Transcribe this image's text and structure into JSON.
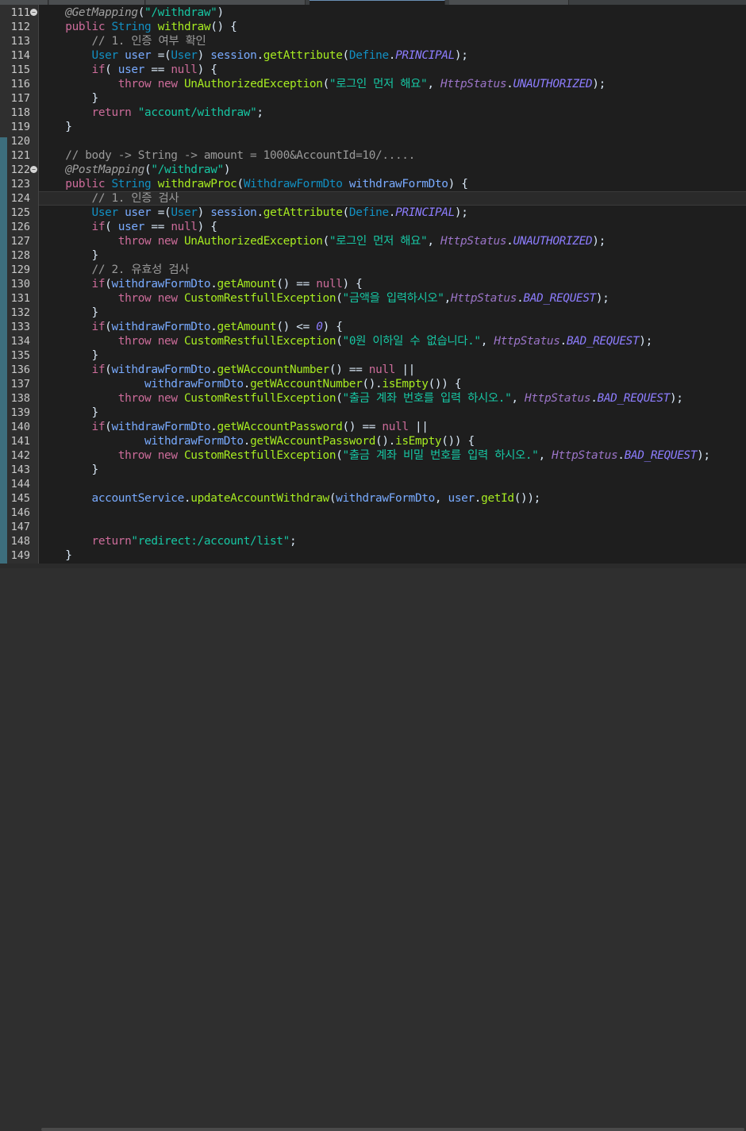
{
  "tabs": [
    "",
    "",
    "",
    "",
    ""
  ],
  "lines": [
    {
      "n": "111",
      "fold": true,
      "t": [
        [
          "    ",
          "txt"
        ],
        [
          "@GetMapping",
          "ann"
        ],
        [
          "(",
          "txt"
        ],
        [
          "\"/withdraw\"",
          "str"
        ],
        [
          ")",
          "txt"
        ]
      ]
    },
    {
      "n": "112",
      "t": [
        [
          "    ",
          "txt"
        ],
        [
          "public",
          "kw"
        ],
        [
          " ",
          "txt"
        ],
        [
          "String",
          "type"
        ],
        [
          " ",
          "txt"
        ],
        [
          "withdraw",
          "meth"
        ],
        [
          "() {",
          "txt"
        ]
      ]
    },
    {
      "n": "113",
      "t": [
        [
          "        ",
          "txt"
        ],
        [
          "// 1. 인증 여부 확인",
          "cmt"
        ]
      ]
    },
    {
      "n": "114",
      "t": [
        [
          "        ",
          "txt"
        ],
        [
          "User",
          "type"
        ],
        [
          " ",
          "txt"
        ],
        [
          "user",
          "var"
        ],
        [
          " =(",
          "txt"
        ],
        [
          "User",
          "type"
        ],
        [
          ") ",
          "txt"
        ],
        [
          "session",
          "var"
        ],
        [
          ".",
          "txt"
        ],
        [
          "getAttribute",
          "meth"
        ],
        [
          "(",
          "txt"
        ],
        [
          "Define",
          "type"
        ],
        [
          ".",
          "txt"
        ],
        [
          "PRINCIPAL",
          "cst"
        ],
        [
          ");",
          "txt"
        ]
      ]
    },
    {
      "n": "115",
      "t": [
        [
          "        ",
          "txt"
        ],
        [
          "if",
          "kw"
        ],
        [
          "( ",
          "txt"
        ],
        [
          "user",
          "var"
        ],
        [
          " == ",
          "txt"
        ],
        [
          "null",
          "kw"
        ],
        [
          ") {",
          "txt"
        ]
      ]
    },
    {
      "n": "116",
      "t": [
        [
          "            ",
          "txt"
        ],
        [
          "throw",
          "kw"
        ],
        [
          " ",
          "txt"
        ],
        [
          "new",
          "kw"
        ],
        [
          " ",
          "txt"
        ],
        [
          "UnAuthorizedException",
          "meth"
        ],
        [
          "(",
          "txt"
        ],
        [
          "\"로그인 먼저 해요\"",
          "str"
        ],
        [
          ", ",
          "txt"
        ],
        [
          "HttpStatus",
          "stat"
        ],
        [
          ".",
          "txt"
        ],
        [
          "UNAUTHORIZED",
          "cst"
        ],
        [
          ");",
          "txt"
        ]
      ]
    },
    {
      "n": "117",
      "t": [
        [
          "        }",
          "txt"
        ]
      ]
    },
    {
      "n": "118",
      "t": [
        [
          "        ",
          "txt"
        ],
        [
          "return",
          "kw"
        ],
        [
          " ",
          "txt"
        ],
        [
          "\"account/withdraw\"",
          "str"
        ],
        [
          ";",
          "txt"
        ]
      ]
    },
    {
      "n": "119",
      "t": [
        [
          "    }",
          "txt"
        ]
      ]
    },
    {
      "n": "120",
      "t": []
    },
    {
      "n": "121",
      "t": [
        [
          "    ",
          "txt"
        ],
        [
          "// body -> String -> amount = 1000&AccountId=10/.....",
          "cmt"
        ]
      ]
    },
    {
      "n": "122",
      "fold": true,
      "t": [
        [
          "    ",
          "txt"
        ],
        [
          "@PostMapping",
          "ann"
        ],
        [
          "(",
          "txt"
        ],
        [
          "\"/withdraw\"",
          "str"
        ],
        [
          ")",
          "txt"
        ]
      ]
    },
    {
      "n": "123",
      "t": [
        [
          "    ",
          "txt"
        ],
        [
          "public",
          "kw"
        ],
        [
          " ",
          "txt"
        ],
        [
          "String",
          "type"
        ],
        [
          " ",
          "txt"
        ],
        [
          "withdrawProc",
          "meth"
        ],
        [
          "(",
          "txt"
        ],
        [
          "WithdrawFormDto",
          "type"
        ],
        [
          " ",
          "txt"
        ],
        [
          "withdrawFormDto",
          "var"
        ],
        [
          ") {",
          "txt"
        ]
      ]
    },
    {
      "n": "124",
      "hl": true,
      "t": [
        [
          "        ",
          "txt"
        ],
        [
          "// 1. 인증 검사",
          "cmt"
        ]
      ]
    },
    {
      "n": "125",
      "t": [
        [
          "        ",
          "txt"
        ],
        [
          "User",
          "type"
        ],
        [
          " ",
          "txt"
        ],
        [
          "user",
          "var"
        ],
        [
          " =(",
          "txt"
        ],
        [
          "User",
          "type"
        ],
        [
          ") ",
          "txt"
        ],
        [
          "session",
          "var"
        ],
        [
          ".",
          "txt"
        ],
        [
          "getAttribute",
          "meth"
        ],
        [
          "(",
          "txt"
        ],
        [
          "Define",
          "type"
        ],
        [
          ".",
          "txt"
        ],
        [
          "PRINCIPAL",
          "cst"
        ],
        [
          ");",
          "txt"
        ]
      ]
    },
    {
      "n": "126",
      "t": [
        [
          "        ",
          "txt"
        ],
        [
          "if",
          "kw"
        ],
        [
          "( ",
          "txt"
        ],
        [
          "user",
          "var"
        ],
        [
          " == ",
          "txt"
        ],
        [
          "null",
          "kw"
        ],
        [
          ") {",
          "txt"
        ]
      ]
    },
    {
      "n": "127",
      "t": [
        [
          "            ",
          "txt"
        ],
        [
          "throw",
          "kw"
        ],
        [
          " ",
          "txt"
        ],
        [
          "new",
          "kw"
        ],
        [
          " ",
          "txt"
        ],
        [
          "UnAuthorizedException",
          "meth"
        ],
        [
          "(",
          "txt"
        ],
        [
          "\"로그인 먼저 해요\"",
          "str"
        ],
        [
          ", ",
          "txt"
        ],
        [
          "HttpStatus",
          "stat"
        ],
        [
          ".",
          "txt"
        ],
        [
          "UNAUTHORIZED",
          "cst"
        ],
        [
          ");",
          "txt"
        ]
      ]
    },
    {
      "n": "128",
      "t": [
        [
          "        }",
          "txt"
        ]
      ]
    },
    {
      "n": "129",
      "t": [
        [
          "        ",
          "txt"
        ],
        [
          "// 2. 유효성 검사",
          "cmt"
        ]
      ]
    },
    {
      "n": "130",
      "t": [
        [
          "        ",
          "txt"
        ],
        [
          "if",
          "kw"
        ],
        [
          "(",
          "txt"
        ],
        [
          "withdrawFormDto",
          "var"
        ],
        [
          ".",
          "txt"
        ],
        [
          "getAmount",
          "meth"
        ],
        [
          "() == ",
          "txt"
        ],
        [
          "null",
          "kw"
        ],
        [
          ") {",
          "txt"
        ]
      ]
    },
    {
      "n": "131",
      "t": [
        [
          "            ",
          "txt"
        ],
        [
          "throw",
          "kw"
        ],
        [
          " ",
          "txt"
        ],
        [
          "new",
          "kw"
        ],
        [
          " ",
          "txt"
        ],
        [
          "CustomRestfullException",
          "meth"
        ],
        [
          "(",
          "txt"
        ],
        [
          "\"금액을 입력하시오\"",
          "str"
        ],
        [
          ",",
          "txt"
        ],
        [
          "HttpStatus",
          "stat"
        ],
        [
          ".",
          "txt"
        ],
        [
          "BAD_REQUEST",
          "cst"
        ],
        [
          ");",
          "txt"
        ]
      ]
    },
    {
      "n": "132",
      "t": [
        [
          "        }",
          "txt"
        ]
      ]
    },
    {
      "n": "133",
      "t": [
        [
          "        ",
          "txt"
        ],
        [
          "if",
          "kw"
        ],
        [
          "(",
          "txt"
        ],
        [
          "withdrawFormDto",
          "var"
        ],
        [
          ".",
          "txt"
        ],
        [
          "getAmount",
          "meth"
        ],
        [
          "() <= ",
          "txt"
        ],
        [
          "0",
          "cst"
        ],
        [
          ") {",
          "txt"
        ]
      ]
    },
    {
      "n": "134",
      "t": [
        [
          "            ",
          "txt"
        ],
        [
          "throw",
          "kw"
        ],
        [
          " ",
          "txt"
        ],
        [
          "new",
          "kw"
        ],
        [
          " ",
          "txt"
        ],
        [
          "CustomRestfullException",
          "meth"
        ],
        [
          "(",
          "txt"
        ],
        [
          "\"0원 이하일 수 없습니다.\"",
          "str"
        ],
        [
          ", ",
          "txt"
        ],
        [
          "HttpStatus",
          "stat"
        ],
        [
          ".",
          "txt"
        ],
        [
          "BAD_REQUEST",
          "cst"
        ],
        [
          ");",
          "txt"
        ]
      ]
    },
    {
      "n": "135",
      "t": [
        [
          "        }",
          "txt"
        ]
      ]
    },
    {
      "n": "136",
      "t": [
        [
          "        ",
          "txt"
        ],
        [
          "if",
          "kw"
        ],
        [
          "(",
          "txt"
        ],
        [
          "withdrawFormDto",
          "var"
        ],
        [
          ".",
          "txt"
        ],
        [
          "getWAccountNumber",
          "meth"
        ],
        [
          "() == ",
          "txt"
        ],
        [
          "null",
          "kw"
        ],
        [
          " ||",
          "txt"
        ]
      ]
    },
    {
      "n": "137",
      "t": [
        [
          "                ",
          "txt"
        ],
        [
          "withdrawFormDto",
          "var"
        ],
        [
          ".",
          "txt"
        ],
        [
          "getWAccountNumber",
          "meth"
        ],
        [
          "().",
          "txt"
        ],
        [
          "isEmpty",
          "meth"
        ],
        [
          "()) {",
          "txt"
        ]
      ]
    },
    {
      "n": "138",
      "t": [
        [
          "            ",
          "txt"
        ],
        [
          "throw",
          "kw"
        ],
        [
          " ",
          "txt"
        ],
        [
          "new",
          "kw"
        ],
        [
          " ",
          "txt"
        ],
        [
          "CustomRestfullException",
          "meth"
        ],
        [
          "(",
          "txt"
        ],
        [
          "\"출금 계좌 번호를 입력 하시오.\"",
          "str"
        ],
        [
          ", ",
          "txt"
        ],
        [
          "HttpStatus",
          "stat"
        ],
        [
          ".",
          "txt"
        ],
        [
          "BAD_REQUEST",
          "cst"
        ],
        [
          ");",
          "txt"
        ]
      ]
    },
    {
      "n": "139",
      "t": [
        [
          "        }",
          "txt"
        ]
      ]
    },
    {
      "n": "140",
      "t": [
        [
          "        ",
          "txt"
        ],
        [
          "if",
          "kw"
        ],
        [
          "(",
          "txt"
        ],
        [
          "withdrawFormDto",
          "var"
        ],
        [
          ".",
          "txt"
        ],
        [
          "getWAccountPassword",
          "meth"
        ],
        [
          "() == ",
          "txt"
        ],
        [
          "null",
          "kw"
        ],
        [
          " ||",
          "txt"
        ]
      ]
    },
    {
      "n": "141",
      "t": [
        [
          "                ",
          "txt"
        ],
        [
          "withdrawFormDto",
          "var"
        ],
        [
          ".",
          "txt"
        ],
        [
          "getWAccountPassword",
          "meth"
        ],
        [
          "().",
          "txt"
        ],
        [
          "isEmpty",
          "meth"
        ],
        [
          "()) {",
          "txt"
        ]
      ]
    },
    {
      "n": "142",
      "t": [
        [
          "            ",
          "txt"
        ],
        [
          "throw",
          "kw"
        ],
        [
          " ",
          "txt"
        ],
        [
          "new",
          "kw"
        ],
        [
          " ",
          "txt"
        ],
        [
          "CustomRestfullException",
          "meth"
        ],
        [
          "(",
          "txt"
        ],
        [
          "\"출금 계좌 비밀 번호를 입력 하시오.\"",
          "str"
        ],
        [
          ", ",
          "txt"
        ],
        [
          "HttpStatus",
          "stat"
        ],
        [
          ".",
          "txt"
        ],
        [
          "BAD_REQUEST",
          "cst"
        ],
        [
          ");",
          "txt"
        ]
      ]
    },
    {
      "n": "143",
      "t": [
        [
          "        }",
          "txt"
        ]
      ]
    },
    {
      "n": "144",
      "t": []
    },
    {
      "n": "145",
      "t": [
        [
          "        ",
          "txt"
        ],
        [
          "accountService",
          "var"
        ],
        [
          ".",
          "txt"
        ],
        [
          "updateAccountWithdraw",
          "meth"
        ],
        [
          "(",
          "txt"
        ],
        [
          "withdrawFormDto",
          "var"
        ],
        [
          ", ",
          "txt"
        ],
        [
          "user",
          "var"
        ],
        [
          ".",
          "txt"
        ],
        [
          "getId",
          "meth"
        ],
        [
          "());",
          "txt"
        ]
      ]
    },
    {
      "n": "146",
      "t": []
    },
    {
      "n": "147",
      "t": []
    },
    {
      "n": "148",
      "t": [
        [
          "        ",
          "txt"
        ],
        [
          "return",
          "kw"
        ],
        [
          "\"redirect:/account/list\"",
          "str"
        ],
        [
          ";",
          "txt"
        ]
      ]
    },
    {
      "n": "149",
      "t": [
        [
          "    }",
          "txt"
        ]
      ]
    }
  ]
}
